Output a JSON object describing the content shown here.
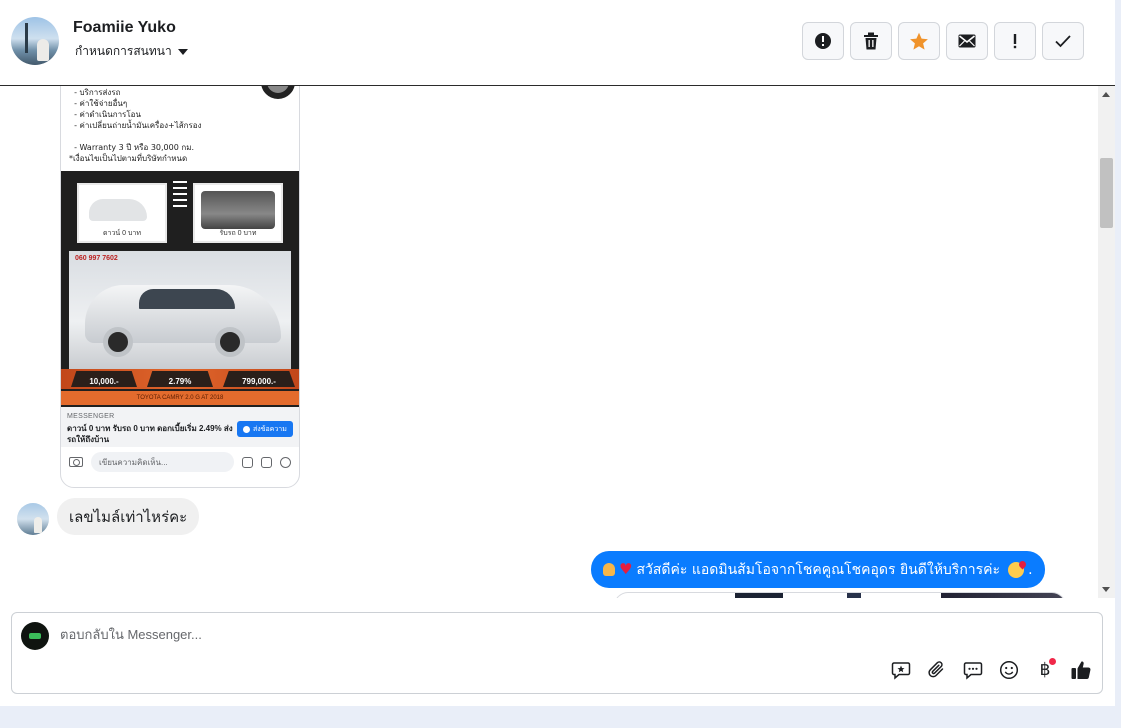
{
  "header": {
    "contact_name": "Foamiie Yuko",
    "assign_label": "กำหนดการสนทนา",
    "actions": [
      {
        "name": "report-spam",
        "icon": "alert-circle-icon"
      },
      {
        "name": "delete",
        "icon": "trash-icon"
      },
      {
        "name": "star",
        "icon": "star-icon",
        "color": "#f0932b"
      },
      {
        "name": "mark-unread",
        "icon": "envelope-icon"
      },
      {
        "name": "follow-up",
        "icon": "exclamation-icon"
      },
      {
        "name": "mark-done",
        "icon": "check-icon"
      }
    ]
  },
  "ad": {
    "top_text": "  - บริการส่งรถ\n  - ค่าใช้จ่ายอื่นๆ\n  - ค่าดำเนินการโอน\n  - ค่าเปลี่ยนถ่ายน้ำมันเครื่อง+ไส้กรอง\n\n  - Warranty 3 ปี หรือ 30,000 กม.\n*เงื่อนไขเป็นไปตามที่บริษัทกำหนด",
    "thumb_left_label": "ดาวน์ 0 บาท",
    "thumb_right_label": "รับรถ 0 บาท",
    "dealer_phone": "060 997 7602",
    "prices": [
      "10,000.-",
      "2.79%",
      "799,000.-"
    ],
    "model": "TOYOTA CAMRY 2.0 G AT 2018",
    "source": "MESSENGER",
    "headline": "ดาวน์ 0 บาท รับรถ 0 บาท ดอกเบี้ยเริ่ม 2.49% ส่งรถให้ถึงบ้าน",
    "cta": "ส่งข้อความ",
    "comment_placeholder": "เขียนความคิดเห็น..."
  },
  "messages": {
    "incoming_text": "เลขไมล์เท่าไหร่คะ",
    "outgoing_text": "สวัสดีค่ะ แอดมินส้มโอจากโชคคูณโชคอุดร ยินดีให้บริการค่ะ",
    "outgoing_suffix": "."
  },
  "composer": {
    "placeholder": "ตอบกลับใน Messenger...",
    "tools": [
      "saved-reply-icon",
      "attachment-icon",
      "chat-bubble-icon",
      "emoji-icon",
      "baht-payment-icon",
      "like-icon"
    ],
    "baht_symbol": "฿"
  },
  "colors": {
    "accent": "#0a7cff",
    "star": "#f0932b",
    "notification": "#f02849"
  }
}
